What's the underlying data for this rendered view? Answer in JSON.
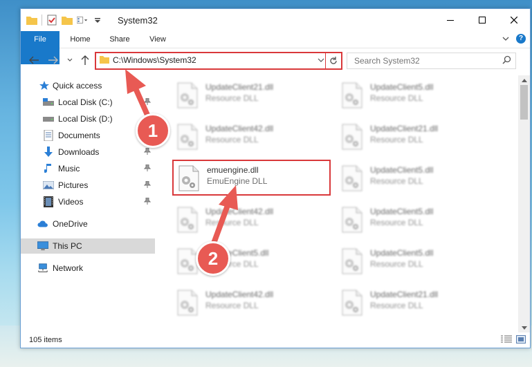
{
  "window": {
    "title": "System32"
  },
  "ribbon": {
    "tabs": [
      "File",
      "Home",
      "Share",
      "View"
    ],
    "help": "?"
  },
  "address": {
    "path": "C:\\Windows\\System32"
  },
  "search": {
    "placeholder": "Search System32"
  },
  "sidebar": {
    "items": [
      {
        "label": "Quick access",
        "icon": "star-icon"
      },
      {
        "label": "Local Disk (C:)",
        "icon": "drive-icon",
        "pinned": true
      },
      {
        "label": "Local Disk (D:)",
        "icon": "drive-icon"
      },
      {
        "label": "Documents",
        "icon": "documents-icon"
      },
      {
        "label": "Downloads",
        "icon": "download-icon",
        "pinned": true
      },
      {
        "label": "Music",
        "icon": "music-icon",
        "pinned": true
      },
      {
        "label": "Pictures",
        "icon": "pictures-icon",
        "pinned": true
      },
      {
        "label": "Videos",
        "icon": "videos-icon",
        "pinned": true
      },
      {
        "label": "OneDrive",
        "icon": "cloud-icon"
      },
      {
        "label": "This PC",
        "icon": "computer-icon",
        "selected": true
      },
      {
        "label": "Network",
        "icon": "network-icon"
      }
    ]
  },
  "files": [
    {
      "name": "UpdateClient21.dll",
      "type": "Resource DLL"
    },
    {
      "name": "UpdateClient5.dll",
      "type": "Resource DLL"
    },
    {
      "name": "UpdateClient42.dll",
      "type": "Resource DLL"
    },
    {
      "name": "UpdateClient21.dll",
      "type": "Resource DLL"
    },
    {
      "name": "emuengine.dll",
      "type": "EmuEngine DLL",
      "highlighted": true
    },
    {
      "name": "UpdateClient5.dll",
      "type": "Resource DLL"
    },
    {
      "name": "UpdateClient42.dll",
      "type": "Resource DLL"
    },
    {
      "name": "UpdateClient5.dll",
      "type": "Resource DLL"
    },
    {
      "name": "UpdateClient5.dll",
      "type": "Resource DLL"
    },
    {
      "name": "UpdateClient5.dll",
      "type": "Resource DLL"
    },
    {
      "name": "UpdateClient42.dll",
      "type": "Resource DLL"
    },
    {
      "name": "UpdateClient21.dll",
      "type": "Resource DLL"
    }
  ],
  "status": {
    "count": "105 items"
  },
  "annotations": {
    "step1": "1",
    "step2": "2"
  },
  "colors": {
    "accent": "#1979ca",
    "highlight": "#d9383a",
    "arrow": "#e85a54"
  }
}
